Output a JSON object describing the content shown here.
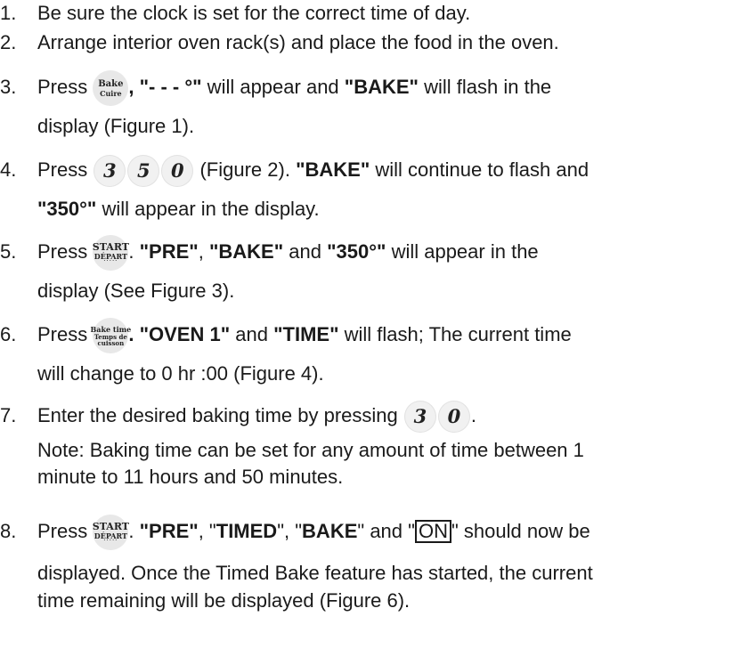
{
  "steps": [
    {
      "num": "1.",
      "line1": "Be sure the clock is set for the correct time of day."
    },
    {
      "num": "2.",
      "line1": "Arrange interior oven rack(s) and place the food in the oven."
    },
    {
      "num": "3.",
      "pre": "Press ",
      "key": {
        "t1": "Bake",
        "t2": "Cuire"
      },
      "b1": ", \"- - - °\"",
      "m1": " will appear and ",
      "b2": "\"BAKE\"",
      "m2": " will flash in the",
      "line2": "display (Figure 1)."
    },
    {
      "num": "4.",
      "pre": "Press ",
      "keys": [
        "3",
        "5",
        "0"
      ],
      "m1": " (Figure 2). ",
      "b1": "\"BAKE\"",
      "m2": " will continue to flash and",
      "b2": "\"350°\"",
      "line2": " will appear in the display."
    },
    {
      "num": "5.",
      "pre": "Press ",
      "key": {
        "t1": "START",
        "t2": "DÉPART"
      },
      "m1": ". ",
      "b1": "\"PRE\"",
      "m2": ", ",
      "b2": "\"BAKE\"",
      "m3": " and ",
      "b3": "\"350°\"",
      "m4": " will appear in the",
      "line2": "display (See Figure 3)."
    },
    {
      "num": "6.",
      "pre": "Press ",
      "key": {
        "t1": "Bake time",
        "t2": "Temps de",
        "t3": "cuisson"
      },
      "b0": ". ",
      "b1": "\"OVEN 1\"",
      "m1": " and ",
      "b2": "\"TIME\"",
      "m2": " will flash; The  current time",
      "line2": "will change to 0 hr :00 (Figure 4)."
    },
    {
      "num": "7.",
      "pre": "Enter the desired baking time by pressing ",
      "keys": [
        "3",
        "0"
      ],
      "post": ".",
      "line2": "Note: Baking time can be set for any amount of time between 1",
      "line3": "minute to 11 hours and 50 minutes."
    },
    {
      "num": "8.",
      "pre": "Press ",
      "key": {
        "t1": "START",
        "t2": "DÉPART"
      },
      "m1": ". ",
      "b1": "\"PRE\"",
      "m2": ", \"",
      "b2": "TIMED",
      "m3": "\", \"",
      "b3": "BAKE",
      "m4": "\" and \"",
      "boxed": "ON",
      "m5": "\" should now be",
      "line2": "displayed. Once the Timed Bake feature has started, the current",
      "line3": "time remaining will be displayed (Figure 6)."
    }
  ]
}
